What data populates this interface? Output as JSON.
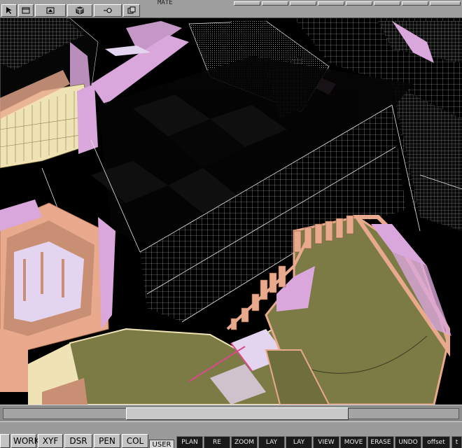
{
  "toolbar": {
    "title_fragment": "MATE",
    "buttons": [
      {
        "name": "select-arrow-icon"
      },
      {
        "name": "window-icon"
      },
      {
        "name": "image-edit-icon"
      },
      {
        "name": "cube-icon"
      },
      {
        "name": "slider-tool-icon"
      },
      {
        "name": "copy-icon"
      }
    ]
  },
  "modes": {
    "work": "WORK",
    "xyf": "XYF",
    "dsr": "DSR",
    "pen": "PEN",
    "col": "COL",
    "user": "USER"
  },
  "commands": [
    {
      "id": "plan",
      "label": "PLAN"
    },
    {
      "id": "redraw",
      "label": "RE"
    },
    {
      "id": "zoom",
      "label": "ZOOM"
    },
    {
      "id": "lay1",
      "label": "LAY"
    },
    {
      "id": "lay2",
      "label": "LAY"
    },
    {
      "id": "view",
      "label": "VIEW"
    },
    {
      "id": "move",
      "label": "MOVE"
    },
    {
      "id": "erase",
      "label": "ERASE"
    },
    {
      "id": "undo",
      "label": "UNDO"
    },
    {
      "id": "offset",
      "label": "offset"
    },
    {
      "id": "more",
      "label": "t"
    }
  ],
  "colors": {
    "viewport_bg": "#000000",
    "wireframe": "#e6e6e6",
    "lilac": "#d9a7dc",
    "salmon": "#e8a98d",
    "olive": "#7c7b46",
    "cream": "#efe3b5",
    "pale_lilac": "#e3d5ef"
  }
}
